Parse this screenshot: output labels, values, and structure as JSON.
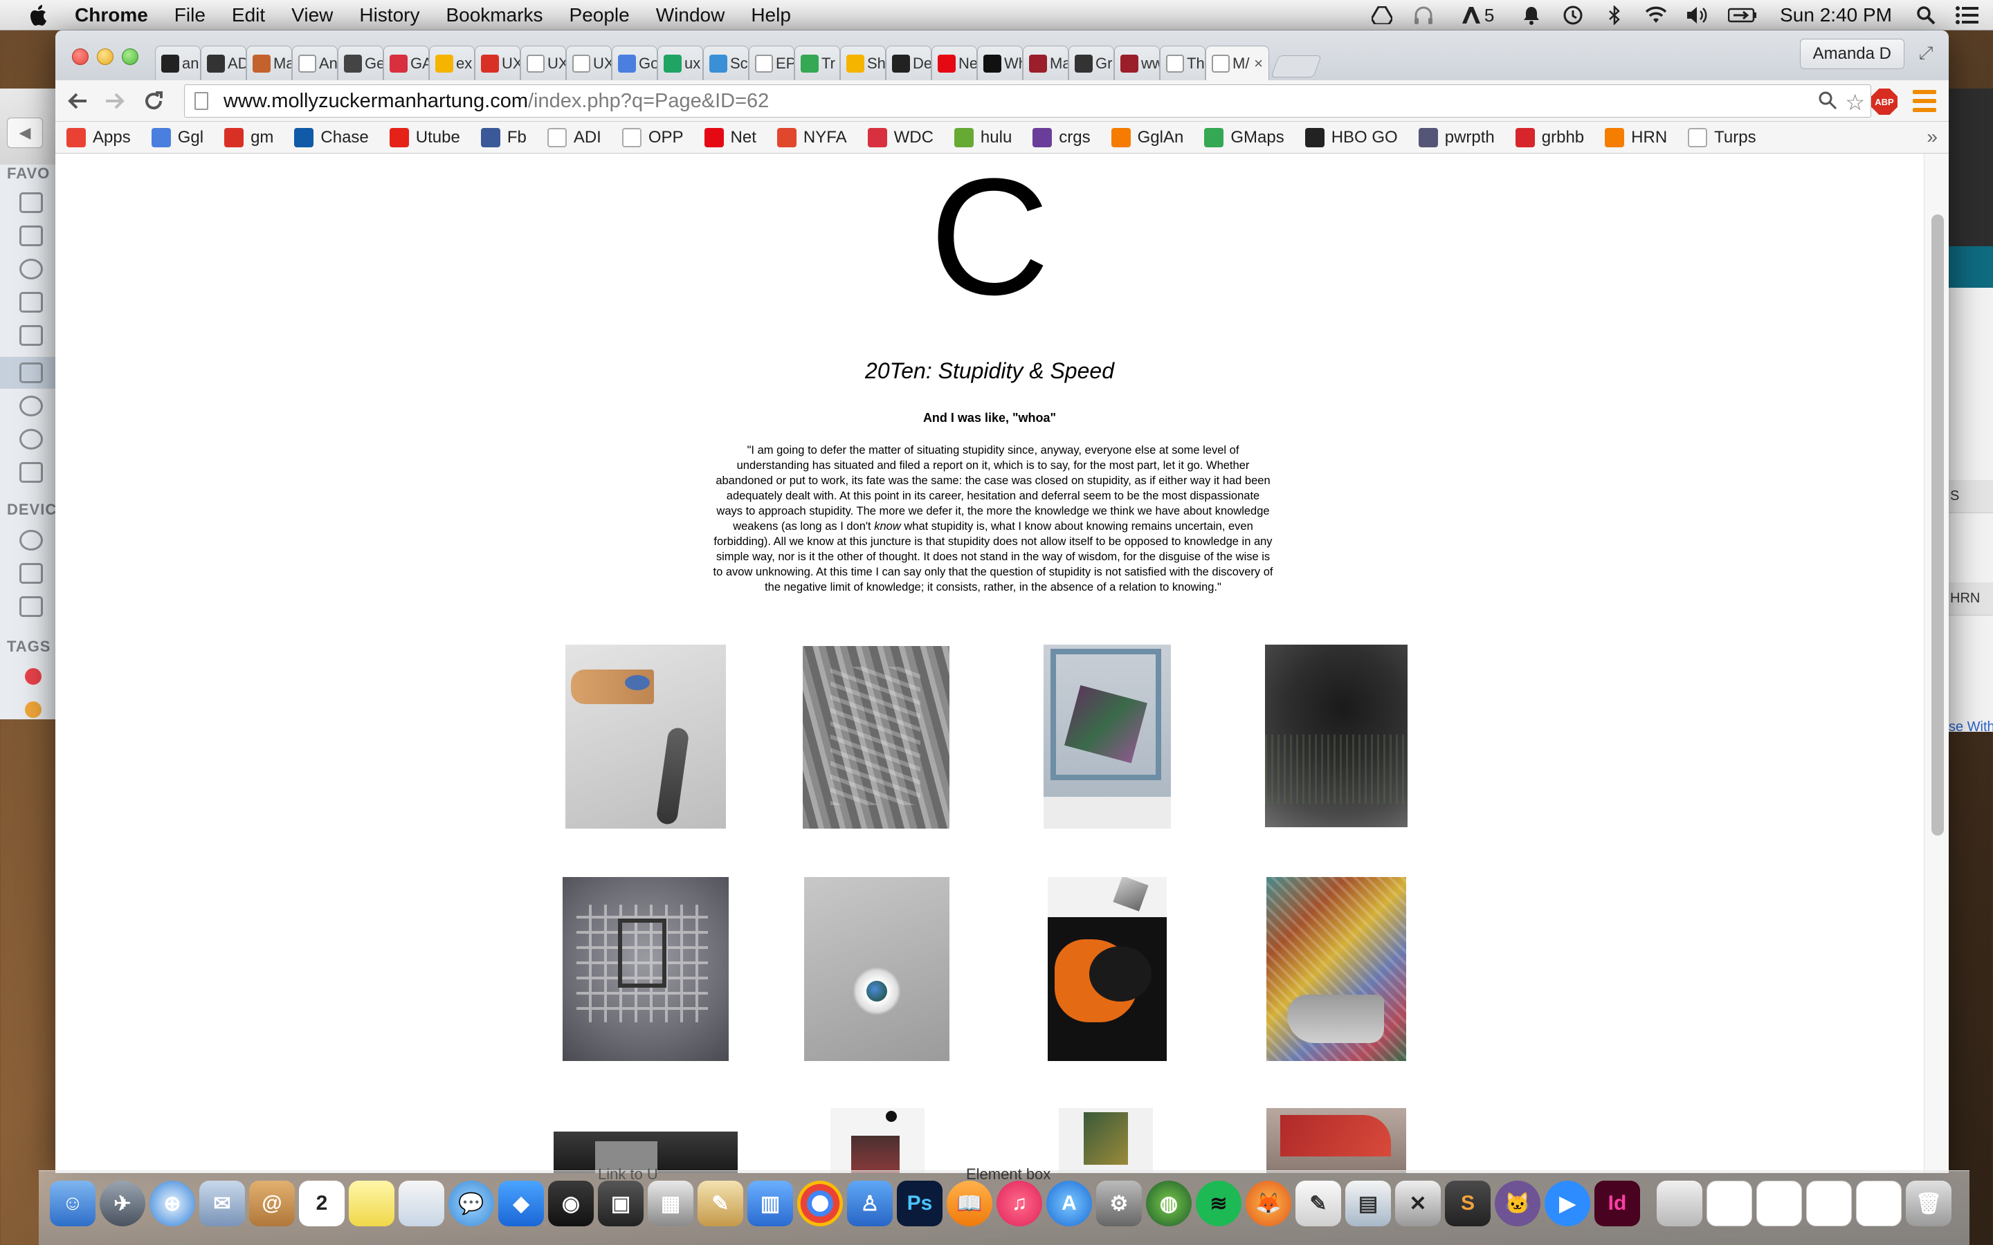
{
  "menubar": {
    "app_name": "Chrome",
    "items": [
      "File",
      "Edit",
      "View",
      "History",
      "Bookmarks",
      "People",
      "Window",
      "Help"
    ],
    "badge_count": "5",
    "clock": "Sun 2:40 PM"
  },
  "finder": {
    "favorites_label": "FAVO",
    "devices_label": "DEVIC",
    "tags_label": "TAGS"
  },
  "right_window": {
    "row1": "S",
    "row2": "HRN",
    "link": "se With"
  },
  "browser": {
    "tabs": [
      {
        "label": "an",
        "icon": "github-icon",
        "color": "#222222"
      },
      {
        "label": "AD",
        "icon": "codepen-icon",
        "color": "#333333"
      },
      {
        "label": "Ma",
        "icon": "fox-icon",
        "color": "#c4622d"
      },
      {
        "label": "An",
        "icon": "page-icon",
        "color": "#ffffff"
      },
      {
        "label": "Ge",
        "icon": "code-icon",
        "color": "#444444"
      },
      {
        "label": "GA",
        "icon": "ga-icon",
        "color": "#d8303f"
      },
      {
        "label": "ex",
        "icon": "slides-icon",
        "color": "#f5b400"
      },
      {
        "label": "UX",
        "icon": "gmail-icon",
        "color": "#d93025"
      },
      {
        "label": "UX",
        "icon": "page-icon",
        "color": "#ffffff"
      },
      {
        "label": "UX",
        "icon": "page-icon",
        "color": "#ffffff"
      },
      {
        "label": "Go",
        "icon": "google-icon",
        "color": "#4a7fe0"
      },
      {
        "label": "ux",
        "icon": "drive-icon",
        "color": "#1fa463"
      },
      {
        "label": "Sc",
        "icon": "settings-icon",
        "color": "#3a8fd6"
      },
      {
        "label": "EP",
        "icon": "page-icon",
        "color": "#ffffff"
      },
      {
        "label": "Tr",
        "icon": "maps-icon",
        "color": "#34a853"
      },
      {
        "label": "Sh",
        "icon": "slides-icon",
        "color": "#f5b400"
      },
      {
        "label": "De",
        "icon": "arrow-icon",
        "color": "#222222"
      },
      {
        "label": "Ne",
        "icon": "netflix-icon",
        "color": "#e50914"
      },
      {
        "label": "Wh",
        "icon": "hex-icon",
        "color": "#111111"
      },
      {
        "label": "Ma",
        "icon": "gw-icon",
        "color": "#9a1f2a"
      },
      {
        "label": "Gr",
        "icon": "tripadvisor-icon",
        "color": "#333333"
      },
      {
        "label": "ww",
        "icon": "gw-icon",
        "color": "#9a1f2a"
      },
      {
        "label": "Th",
        "icon": "page-icon",
        "color": "#ffffff"
      },
      {
        "label": "M/",
        "icon": "page-icon",
        "color": "#ffffff"
      }
    ],
    "profile_name": "Amanda D",
    "url_host": "www.mollyzuckermanhartung.com",
    "url_path": "/index.php?q=Page&ID=62",
    "abp_label": "ABP",
    "bookmarks": [
      {
        "label": "Apps",
        "icon": "apps-grid-icon",
        "color": "#e94235"
      },
      {
        "label": "Ggl",
        "icon": "google-icon",
        "color": "#4a7fe0"
      },
      {
        "label": "gm",
        "icon": "gmail-icon",
        "color": "#d93025"
      },
      {
        "label": "Chase",
        "icon": "chase-icon",
        "color": "#115aa8"
      },
      {
        "label": "Utube",
        "icon": "youtube-icon",
        "color": "#e62117"
      },
      {
        "label": "Fb",
        "icon": "facebook-icon",
        "color": "#3b5998"
      },
      {
        "label": "ADI",
        "icon": "page-icon",
        "color": "#ffffff"
      },
      {
        "label": "OPP",
        "icon": "search-icon",
        "color": "#ffffff"
      },
      {
        "label": "Net",
        "icon": "netflix-icon",
        "color": "#e50914"
      },
      {
        "label": "NYFA",
        "icon": "bars-icon",
        "color": "#e0472c"
      },
      {
        "label": "WDC",
        "icon": "ga-icon",
        "color": "#d8303f"
      },
      {
        "label": "hulu",
        "icon": "hulu-icon",
        "color": "#66aa33"
      },
      {
        "label": "crgs",
        "icon": "peace-icon",
        "color": "#6a3d9a"
      },
      {
        "label": "GglAn",
        "icon": "analytics-icon",
        "color": "#f57c00"
      },
      {
        "label": "GMaps",
        "icon": "maps-icon",
        "color": "#34a853"
      },
      {
        "label": "HBO GO",
        "icon": "hbo-icon",
        "color": "#222222"
      },
      {
        "label": "pwrpth",
        "icon": "powerpath-icon",
        "color": "#555577"
      },
      {
        "label": "grbhb",
        "icon": "grubhub-icon",
        "color": "#d6262b"
      },
      {
        "label": "HRN",
        "icon": "blogger-icon",
        "color": "#f57d00"
      },
      {
        "label": "Turps",
        "icon": "page-icon",
        "color": "#ffffff"
      }
    ]
  },
  "page": {
    "big_letter": "C",
    "title": "20Ten: Stupidity & Speed",
    "quote_heading": "And I was like, \"whoa\"",
    "quote_part1": "\"I am going to defer the matter of situating stupidity since, anyway, everyone else at some level of understanding has situated and filed a report on it, which is to say, for the most part, let it go. Whether abandoned or put to work, its fate was the same: the case was closed on stupidity, as if either way it had been adequately dealt with. At this point in its career, hesitation and deferral seem to be the most dispassionate ways to approach stupidity. The more we defer it, the more the knowledge we think we have about knowledge weakens (as long as I don't ",
    "quote_emphasis": "know",
    "quote_part2": " what stupidity is, what I know about knowing remains uncertain, even forbidding). All we know at this juncture is that stupidity does not allow itself to be opposed to knowledge in any simple way, nor is it the other of thought. It does not stand in the way of wisdom, for the disguise of the wise is to avow unknowing. At this time I can say only that the question of stupidity is not satisfied with the discovery of the negative limit of knowledge; it consists, rather, in the absence of a relation to knowing.\""
  },
  "dock": {
    "calendar_day": "2",
    "hover_label": "Element box",
    "link_label": "Link to U"
  }
}
